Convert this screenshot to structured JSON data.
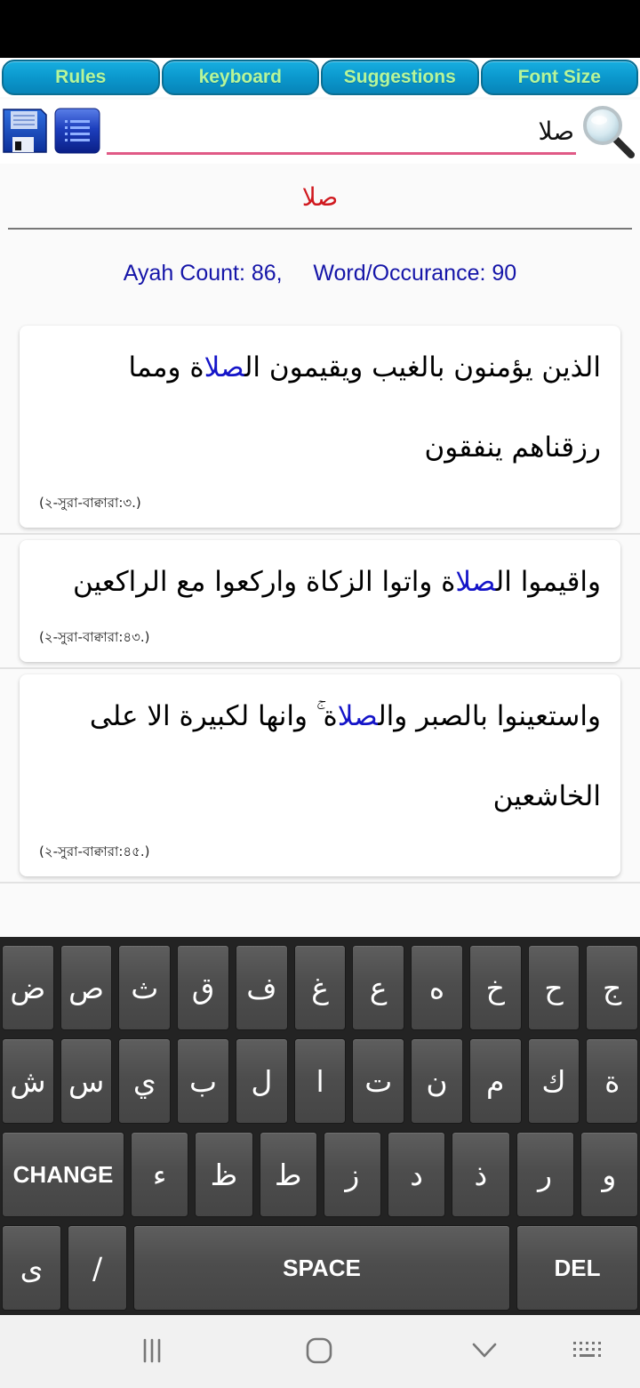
{
  "top_tabs": [
    {
      "label": "Rules"
    },
    {
      "label": "keyboard"
    },
    {
      "label": "Suggestions"
    },
    {
      "label": "Font Size"
    }
  ],
  "search": {
    "value": "صلا",
    "icons": {
      "save": "floppy-disk-icon",
      "list": "list-icon",
      "search": "magnifier-icon"
    }
  },
  "query_title": "صلا",
  "stats": {
    "ayah_count_label": "Ayah Count: 86,",
    "word_occurance_label": "Word/Occurance: 90",
    "ayah_count": 86,
    "word_occurance": 90
  },
  "results": [
    {
      "before": "الذين يؤمنون بالغيب ويقيمون ال",
      "highlight": "صلا",
      "after": "ة ومما رزقناهم ينفقون",
      "reference": "(২-সুরা-বাক্বারা:৩.)"
    },
    {
      "before": "واقيموا ال",
      "highlight": "صلا",
      "after": "ة واتوا الزكاة واركعوا مع الراكعين",
      "reference": "(২-সুরা-বাক্বারা:৪৩.)"
    },
    {
      "before": "واستعينوا بالصبر وال",
      "highlight": "صلا",
      "after": "ة ۚ وانها لكبيرة الا على الخاشعين",
      "reference": "(২-সুরা-বাক্বারা:৪৫.)"
    }
  ],
  "keyboard": {
    "row1": [
      "ض",
      "ص",
      "ث",
      "ق",
      "ف",
      "غ",
      "ع",
      "ه",
      "خ",
      "ح",
      "ج"
    ],
    "row2": [
      "ش",
      "س",
      "ي",
      "ب",
      "ل",
      "ا",
      "ت",
      "ن",
      "م",
      "ك",
      "ة"
    ],
    "row3": {
      "change": "CHANGE",
      "keys": [
        "ء",
        "ظ",
        "ط",
        "ز",
        "د",
        "ذ",
        "ر",
        "و"
      ]
    },
    "row4": {
      "keys": [
        "ى",
        "/"
      ],
      "space": "SPACE",
      "del": "DEL"
    }
  },
  "colors": {
    "tab_text": "#b6f59a",
    "tab_bg": "#0b98cd",
    "query_title": "#d0191f",
    "stats_text": "#1515a8",
    "highlight": "#1414c8",
    "input_underline": "#e05a86"
  },
  "nav_bar": {
    "icons": [
      "recent-apps-icon",
      "home-icon",
      "back-chevron-icon",
      "keyboard-switch-icon"
    ]
  }
}
